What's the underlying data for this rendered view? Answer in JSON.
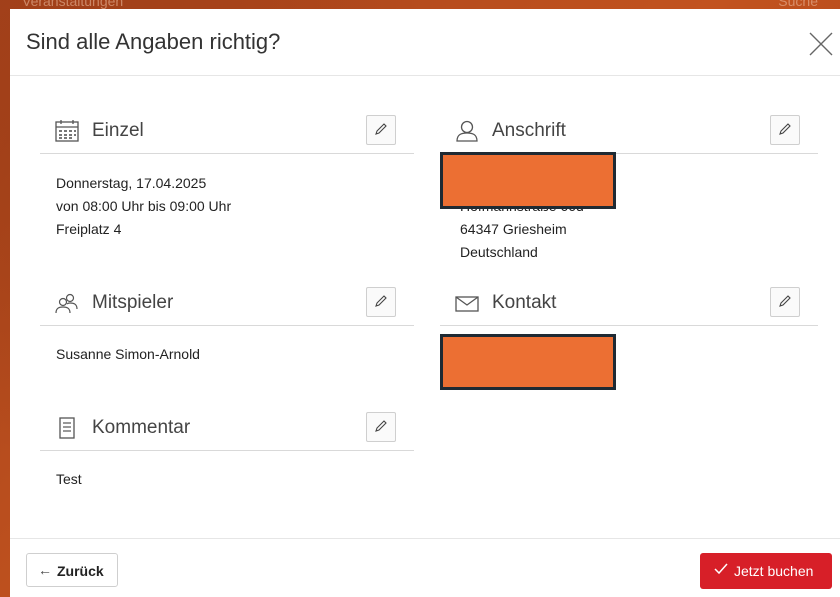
{
  "background": {
    "left_text": "Veranstaltungen",
    "right_text": "Suche"
  },
  "modal": {
    "title": "Sind alle Angaben richtig?"
  },
  "sections": {
    "einzel": {
      "title": "Einzel",
      "icon": "calendar-icon",
      "lines": [
        "Donnerstag, 17.04.2025",
        "von 08:00 Uhr bis 09:00 Uhr",
        "Freiplatz 4"
      ]
    },
    "anschrift": {
      "title": "Anschrift",
      "icon": "user-icon",
      "lines": [
        "Hofmannstraße 66d",
        "64347 Griesheim",
        "Deutschland"
      ]
    },
    "mitspieler": {
      "title": "Mitspieler",
      "icon": "users-icon",
      "lines": [
        "Susanne Simon-Arnold"
      ]
    },
    "kontakt": {
      "title": "Kontakt",
      "icon": "mail-icon",
      "lines": []
    },
    "kommentar": {
      "title": "Kommentar",
      "icon": "document-icon",
      "lines": [
        "Test"
      ]
    }
  },
  "footer": {
    "back_label": "Zurück",
    "book_label": "Jetzt buchen"
  },
  "colors": {
    "accent": "#d71f28",
    "redaction": "#ec6f33",
    "backdrop": "#b5481f"
  }
}
